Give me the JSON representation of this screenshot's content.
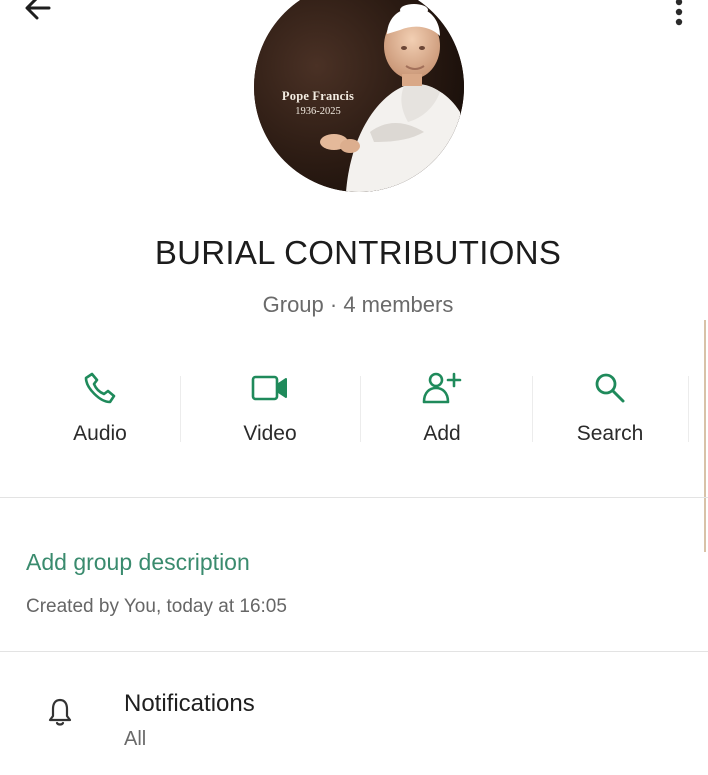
{
  "avatar": {
    "name": "Pope Francis",
    "dates": "1936-2025"
  },
  "group": {
    "title": "BURIAL CONTRIBUTIONS",
    "subtitle": "Group · 4 members"
  },
  "actions": [
    {
      "label": "Audio",
      "icon": "phone-icon"
    },
    {
      "label": "Video",
      "icon": "video-camera-icon"
    },
    {
      "label": "Add",
      "icon": "add-person-icon"
    },
    {
      "label": "Search",
      "icon": "search-icon"
    }
  ],
  "description": {
    "add_label": "Add group description",
    "created": "Created by You, today at 16:05"
  },
  "notifications": {
    "title": "Notifications",
    "value": "All"
  },
  "colors": {
    "accent": "#1f8a5b",
    "link": "#3a8b6e"
  }
}
